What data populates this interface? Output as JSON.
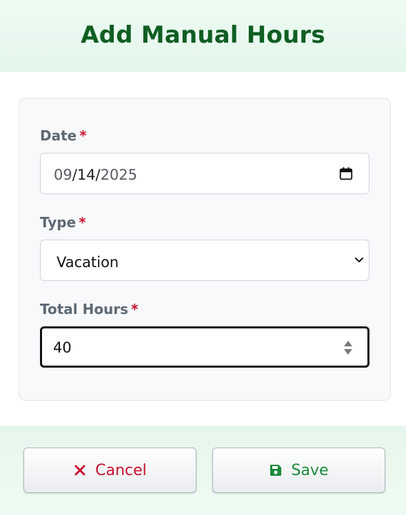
{
  "dialog": {
    "title": "Add Manual Hours"
  },
  "form": {
    "date": {
      "label": "Date",
      "required_mark": "*",
      "value_month": "09",
      "sep1": "/",
      "value_day": "14",
      "sep2": "/",
      "value_year": "2025"
    },
    "type": {
      "label": "Type",
      "required_mark": "*",
      "selected": "Vacation"
    },
    "total_hours": {
      "label": "Total Hours",
      "required_mark": "*",
      "value": "40"
    }
  },
  "footer": {
    "cancel_label": "Cancel",
    "save_label": "Save"
  },
  "icons": {
    "date": "calendar-icon",
    "type": "chevron-down-icon",
    "hours": "spinner-icon",
    "cancel": "close-icon",
    "save": "floppy-disk-icon"
  },
  "colors": {
    "title": "#0f5e22",
    "required": "#c8102e",
    "cancel": "#c8102e",
    "save": "#1a8a3a"
  }
}
